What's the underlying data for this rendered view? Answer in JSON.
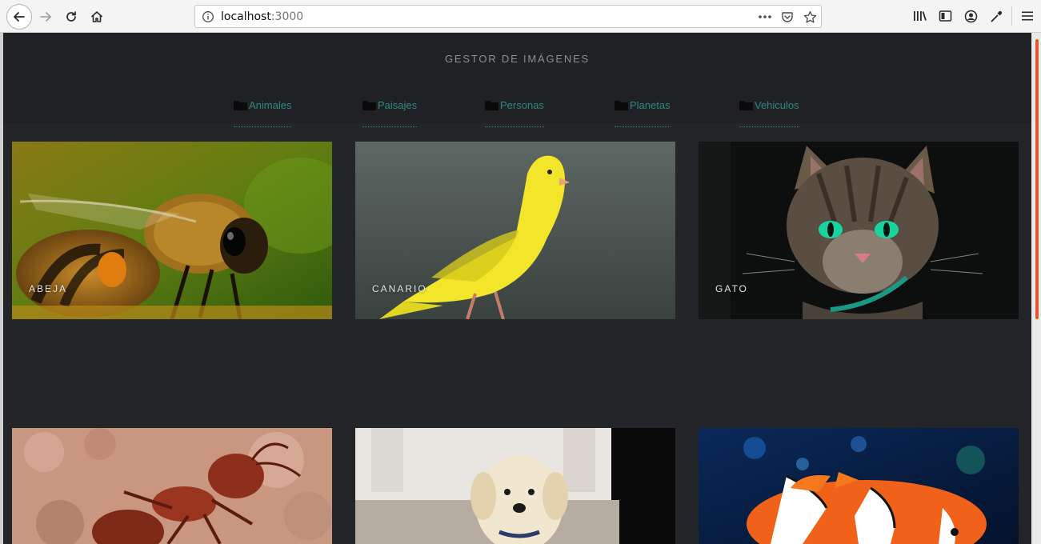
{
  "browser": {
    "url_host": "localhost",
    "url_port": ":3000",
    "icons": [
      "back-icon",
      "forward-icon",
      "reload-icon",
      "home-icon",
      "info-icon",
      "page-actions-icon",
      "pocket-icon",
      "bookmark-star-icon",
      "library-icon",
      "sidebar-icon",
      "account-icon",
      "eyedropper-icon",
      "hamburger-menu-icon"
    ]
  },
  "site": {
    "title": "GESTOR DE IMÁGENES"
  },
  "nav": {
    "items": [
      {
        "label": "Animales"
      },
      {
        "label": "Paisajes"
      },
      {
        "label": "Personas"
      },
      {
        "label": "Planetas"
      },
      {
        "label": "Vehiculos"
      }
    ]
  },
  "gallery": {
    "cards": [
      {
        "label": "ABEJA",
        "image": "bee-photo"
      },
      {
        "label": "CANARIO",
        "image": "canary-photo"
      },
      {
        "label": "GATO",
        "image": "cat-photo"
      },
      {
        "label": "",
        "image": "ant-photo"
      },
      {
        "label": "",
        "image": "puppy-photo"
      },
      {
        "label": "",
        "image": "clownfish-photo"
      }
    ]
  },
  "colors": {
    "page_bg": "#232528",
    "header_bg": "#1f2124",
    "nav_link": "#2e8a7e",
    "title_text": "#8b8f93",
    "scroll_thumb": "#e2582c"
  }
}
